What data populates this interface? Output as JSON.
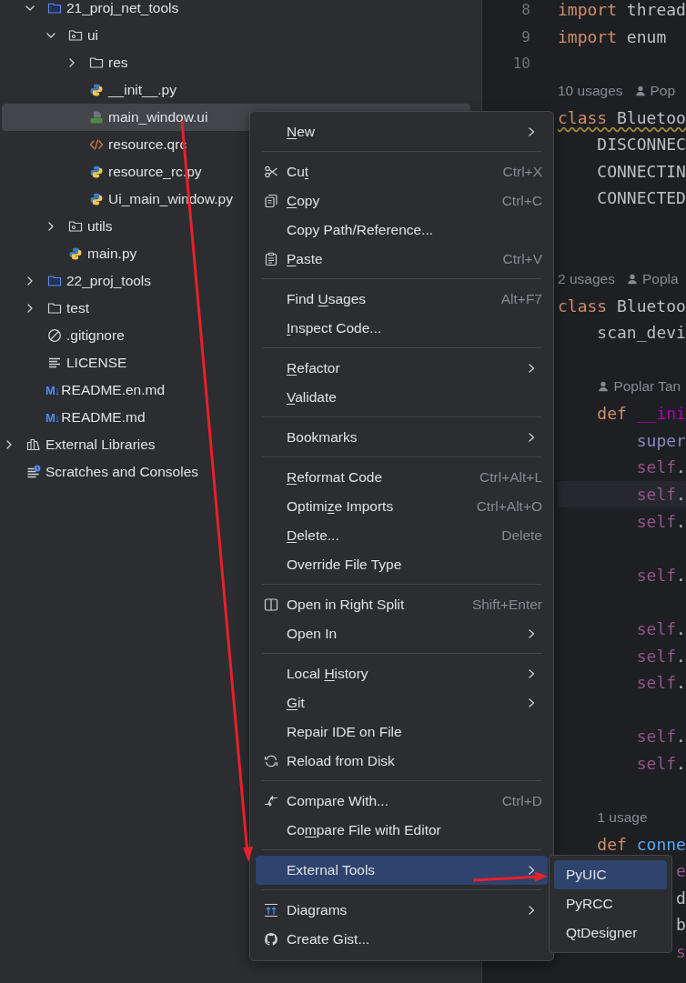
{
  "project_tree": [
    {
      "children": [
        {
          "label": "21_proj_net_tools",
          "kind": "source_folder",
          "expanded": true,
          "selected": false,
          "children": [
            {
              "label": "ui",
              "kind": "module",
              "expanded": true,
              "selected": false,
              "children": [
                {
                  "label": "res",
                  "kind": "folder",
                  "expanded": false,
                  "selected": false
                },
                {
                  "label": "__init__.py",
                  "kind": "python",
                  "selected": false
                },
                {
                  "label": "main_window.ui",
                  "kind": "qt",
                  "selected": true
                },
                {
                  "label": "resource.qrc",
                  "kind": "qrc",
                  "selected": false
                },
                {
                  "label": "resource_rc.py",
                  "kind": "python",
                  "selected": false
                },
                {
                  "label": "Ui_main_window.py",
                  "kind": "python",
                  "selected": false
                }
              ]
            },
            {
              "label": "utils",
              "kind": "module",
              "expanded": false,
              "selected": false
            },
            {
              "label": "main.py",
              "kind": "python",
              "selected": false
            }
          ]
        },
        {
          "label": "22_proj_tools",
          "kind": "source_folder",
          "expanded": false,
          "selected": false
        },
        {
          "label": "test",
          "kind": "folder",
          "expanded": false,
          "selected": false
        },
        {
          "label": ".gitignore",
          "kind": "ignore",
          "selected": false
        },
        {
          "label": "LICENSE",
          "kind": "text",
          "selected": false
        },
        {
          "label": "README.en.md",
          "kind": "markdown",
          "badge": "M↓",
          "selected": false
        },
        {
          "label": "README.md",
          "kind": "markdown",
          "badge": "M↓",
          "selected": false
        }
      ]
    },
    {
      "label": "External Libraries",
      "kind": "libraries",
      "expanded": false,
      "selected": false
    },
    {
      "label": "Scratches and Consoles",
      "kind": "scratches",
      "selected": false
    }
  ],
  "editor": {
    "lines": [
      {
        "number": "8",
        "tokens": [
          {
            "kind": "kw",
            "t": "import"
          },
          {
            "kind": "plain",
            "t": " thread"
          }
        ]
      },
      {
        "number": "9",
        "tokens": [
          {
            "kind": "kw",
            "t": "import"
          },
          {
            "kind": "plain",
            "t": " enum"
          }
        ]
      },
      {
        "number": "10",
        "kind": "blank"
      },
      {
        "kind": "hint",
        "usages": "10 usages",
        "author": "Pop"
      },
      {
        "tokens": [
          {
            "kind": "kw",
            "t": "class"
          },
          {
            "kind": "plain",
            "t": " Bluetoo"
          }
        ],
        "warning": true
      },
      {
        "tokens": [
          {
            "kind": "plain",
            "t": "    DISCONNEC"
          }
        ]
      },
      {
        "tokens": [
          {
            "kind": "plain",
            "t": "    CONNECTIN"
          }
        ]
      },
      {
        "tokens": [
          {
            "kind": "plain",
            "t": "    CONNECTED"
          }
        ]
      },
      {
        "kind": "blank"
      },
      {
        "kind": "blank"
      },
      {
        "kind": "hint",
        "usages": "2 usages",
        "author": "Popla"
      },
      {
        "tokens": [
          {
            "kind": "kw",
            "t": "class"
          },
          {
            "kind": "plain",
            "t": " Bluetoo"
          }
        ]
      },
      {
        "tokens": [
          {
            "kind": "plain",
            "t": "    scan_devi"
          }
        ]
      },
      {
        "kind": "blank"
      },
      {
        "kind": "hint",
        "indented": true,
        "author": "Poplar Tan"
      },
      {
        "tokens": [
          {
            "kind": "kw",
            "t": "    def"
          },
          {
            "kind": "magic",
            "t": " __ini"
          }
        ]
      },
      {
        "tokens": [
          {
            "kind": "builtin",
            "t": "        super"
          }
        ]
      },
      {
        "tokens": [
          {
            "kind": "self",
            "t": "        self"
          },
          {
            "kind": "plain",
            "t": "."
          }
        ]
      },
      {
        "tokens": [
          {
            "kind": "self",
            "t": "        self"
          },
          {
            "kind": "plain",
            "t": "."
          }
        ],
        "current": true
      },
      {
        "tokens": [
          {
            "kind": "self",
            "t": "        self"
          },
          {
            "kind": "plain",
            "t": "."
          }
        ]
      },
      {
        "kind": "blank"
      },
      {
        "tokens": [
          {
            "kind": "self",
            "t": "        self"
          },
          {
            "kind": "plain",
            "t": "."
          }
        ]
      },
      {
        "kind": "blank"
      },
      {
        "tokens": [
          {
            "kind": "self",
            "t": "        self"
          },
          {
            "kind": "plain",
            "t": "."
          }
        ]
      },
      {
        "tokens": [
          {
            "kind": "self",
            "t": "        self"
          },
          {
            "kind": "plain",
            "t": "."
          }
        ]
      },
      {
        "tokens": [
          {
            "kind": "self",
            "t": "        self"
          },
          {
            "kind": "plain",
            "t": "."
          }
        ]
      },
      {
        "kind": "blank"
      },
      {
        "tokens": [
          {
            "kind": "self",
            "t": "        self"
          },
          {
            "kind": "plain",
            "t": "."
          }
        ]
      },
      {
        "tokens": [
          {
            "kind": "self",
            "t": "        self"
          },
          {
            "kind": "plain",
            "t": "."
          }
        ]
      },
      {
        "kind": "blank"
      },
      {
        "kind": "hint",
        "indented": true,
        "usages": "1 usage"
      },
      {
        "tokens": [
          {
            "kind": "kw",
            "t": "    def"
          },
          {
            "kind": "func",
            "t": " conne"
          }
        ]
      },
      {
        "tokens": [
          {
            "kind": "self",
            "t": "            e"
          }
        ]
      },
      {
        "tokens": [
          {
            "kind": "plain",
            "t": "            d"
          }
        ]
      },
      {
        "tokens": [
          {
            "kind": "plain",
            "t": "            b"
          }
        ]
      },
      {
        "tokens": [
          {
            "kind": "self",
            "t": "            s"
          }
        ]
      }
    ]
  },
  "context_menu": {
    "items": [
      {
        "kind": "plain",
        "label": {
          "key": "N",
          "after": "ew"
        },
        "submenu": true,
        "selected": false
      },
      {
        "kind": "separator"
      },
      {
        "kind": "scissors",
        "label": {
          "before": "Cu",
          "key": "t"
        },
        "shortcut": "Ctrl+X",
        "selected": false
      },
      {
        "kind": "copy",
        "label": {
          "key": "C",
          "after": "opy"
        },
        "shortcut": "Ctrl+C",
        "selected": false
      },
      {
        "kind": "plain",
        "label": "Copy Path/Reference...",
        "selected": false
      },
      {
        "kind": "paste",
        "label": {
          "key": "P",
          "after": "aste"
        },
        "shortcut": "Ctrl+V",
        "selected": false
      },
      {
        "kind": "separator"
      },
      {
        "kind": "plain",
        "label": {
          "before": "Find ",
          "key": "U",
          "after": "sages"
        },
        "shortcut": "Alt+F7",
        "selected": false
      },
      {
        "kind": "plain",
        "label": {
          "key": "I",
          "after": "nspect Code..."
        },
        "selected": false
      },
      {
        "kind": "separator"
      },
      {
        "kind": "plain",
        "label": {
          "key": "R",
          "after": "efactor"
        },
        "submenu": true,
        "selected": false
      },
      {
        "kind": "plain",
        "label": {
          "key": "V",
          "after": "alidate"
        },
        "selected": false
      },
      {
        "kind": "separator"
      },
      {
        "kind": "plain",
        "label": "Bookmarks",
        "submenu": true,
        "selected": false
      },
      {
        "kind": "separator"
      },
      {
        "kind": "plain",
        "label": {
          "key": "R",
          "after": "eformat Code"
        },
        "shortcut": "Ctrl+Alt+L",
        "selected": false
      },
      {
        "kind": "plain",
        "label": {
          "before": "Optimi",
          "key": "z",
          "after": "e Imports"
        },
        "shortcut": "Ctrl+Alt+O",
        "selected": false
      },
      {
        "kind": "plain",
        "label": {
          "key": "D",
          "after": "elete..."
        },
        "shortcut": "Delete",
        "selected": false
      },
      {
        "kind": "plain",
        "label": "Override File Type",
        "selected": false
      },
      {
        "kind": "separator"
      },
      {
        "kind": "split",
        "label": "Open in Right Split",
        "shortcut": "Shift+Enter",
        "selected": false
      },
      {
        "kind": "plain",
        "label": "Open In",
        "submenu": true,
        "selected": false
      },
      {
        "kind": "separator"
      },
      {
        "kind": "plain",
        "label": {
          "before": "Local ",
          "key": "H",
          "after": "istory"
        },
        "submenu": true,
        "selected": false
      },
      {
        "kind": "plain",
        "label": {
          "key": "G",
          "after": "it"
        },
        "submenu": true,
        "selected": false
      },
      {
        "kind": "plain",
        "label": "Repair IDE on File",
        "selected": false
      },
      {
        "kind": "reload",
        "label": "Reload from Disk",
        "selected": false
      },
      {
        "kind": "separator"
      },
      {
        "kind": "compare",
        "label": "Compare With...",
        "shortcut": "Ctrl+D",
        "selected": false
      },
      {
        "kind": "plain",
        "label": {
          "before": "Co",
          "key": "m",
          "after": "pare File with Editor"
        },
        "selected": false
      },
      {
        "kind": "separator"
      },
      {
        "kind": "plain",
        "label": "External Tools",
        "submenu": true,
        "selected": true
      },
      {
        "kind": "separator"
      },
      {
        "kind": "diagram",
        "label": "Diagrams",
        "submenu": true,
        "selected": false
      },
      {
        "kind": "cat",
        "label": "Create Gist...",
        "selected": false
      }
    ]
  },
  "submenu": {
    "items": [
      {
        "label": "PyUIC",
        "selected": true
      },
      {
        "label": "PyRCC",
        "selected": false
      },
      {
        "label": "QtDesigner",
        "selected": false
      }
    ]
  }
}
